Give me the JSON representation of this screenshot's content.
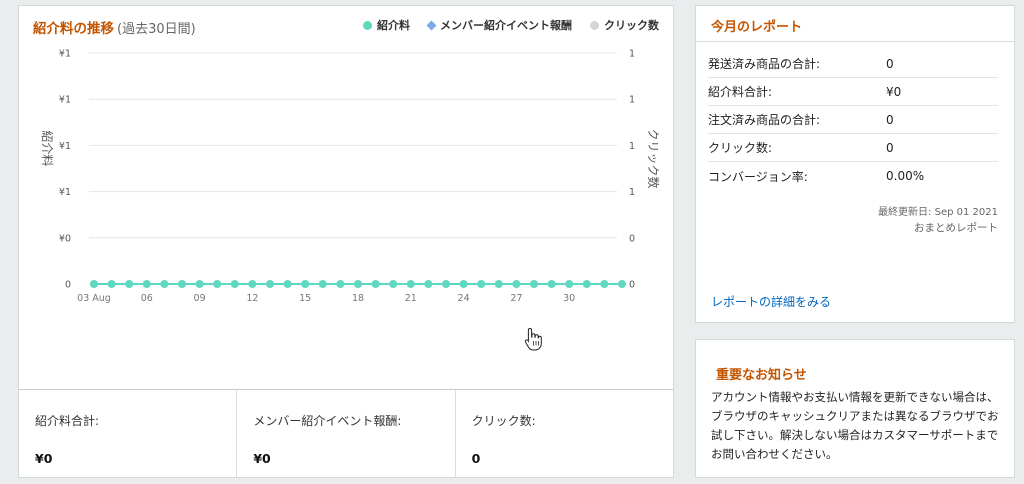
{
  "chart_panel": {
    "title": "紹介料の推移",
    "subtitle": "(過去30日間)",
    "legend": [
      {
        "label": "紹介料",
        "color": "#5fd8c0",
        "marker": "dot"
      },
      {
        "label": "メンバー紹介イベント報酬",
        "color": "#7aa9e6",
        "marker": "diamond"
      },
      {
        "label": "クリック数",
        "color": "#d6d6d6",
        "marker": "dot"
      }
    ]
  },
  "chart_data": {
    "type": "line",
    "y_left_label": "紹介料",
    "y_right_label": "クリック数",
    "y_left_ticks": [
      "¥1",
      "¥1",
      "¥1",
      "¥1",
      "¥0",
      "0"
    ],
    "y_right_ticks": [
      "1",
      "1",
      "1",
      "1",
      "0",
      "0"
    ],
    "x_tick_labels": [
      "03 Aug",
      "06",
      "09",
      "12",
      "15",
      "18",
      "21",
      "24",
      "27",
      "30"
    ],
    "x_start_day": 3,
    "x_end_day": 33,
    "series": [
      {
        "name": "紹介料",
        "color": "#5fd8c0",
        "values": [
          0,
          0,
          0,
          0,
          0,
          0,
          0,
          0,
          0,
          0,
          0,
          0,
          0,
          0,
          0,
          0,
          0,
          0,
          0,
          0,
          0,
          0,
          0,
          0,
          0,
          0,
          0,
          0,
          0,
          0,
          0
        ]
      }
    ],
    "ylim": [
      0,
      1
    ]
  },
  "stats": [
    {
      "label": "紹介料合計:",
      "value": "¥0"
    },
    {
      "label": "メンバー紹介イベント報酬:",
      "value": "¥0"
    },
    {
      "label": "クリック数:",
      "value": "0"
    }
  ],
  "report": {
    "title": "今月のレポート",
    "rows": [
      {
        "key": "発送済み商品の合計:",
        "value": "0"
      },
      {
        "key": "紹介料合計:",
        "value": "¥0"
      },
      {
        "key": "注文済み商品の合計:",
        "value": "0"
      },
      {
        "key": "クリック数:",
        "value": "0"
      },
      {
        "key": "コンバージョン率:",
        "value": "0.00%"
      }
    ],
    "updated": "最終更新日: Sep 01 2021",
    "subtitle": "おまとめレポート",
    "link": "レポートの詳細をみる"
  },
  "notice": {
    "title": "重要なお知らせ",
    "text": "アカウント情報やお支払い情報を更新できない場合は、ブラウザのキャッシュクリアまたは異なるブラウザでお試し下さい。解決しない場合はカスタマーサポートまでお問い合わせください。"
  }
}
